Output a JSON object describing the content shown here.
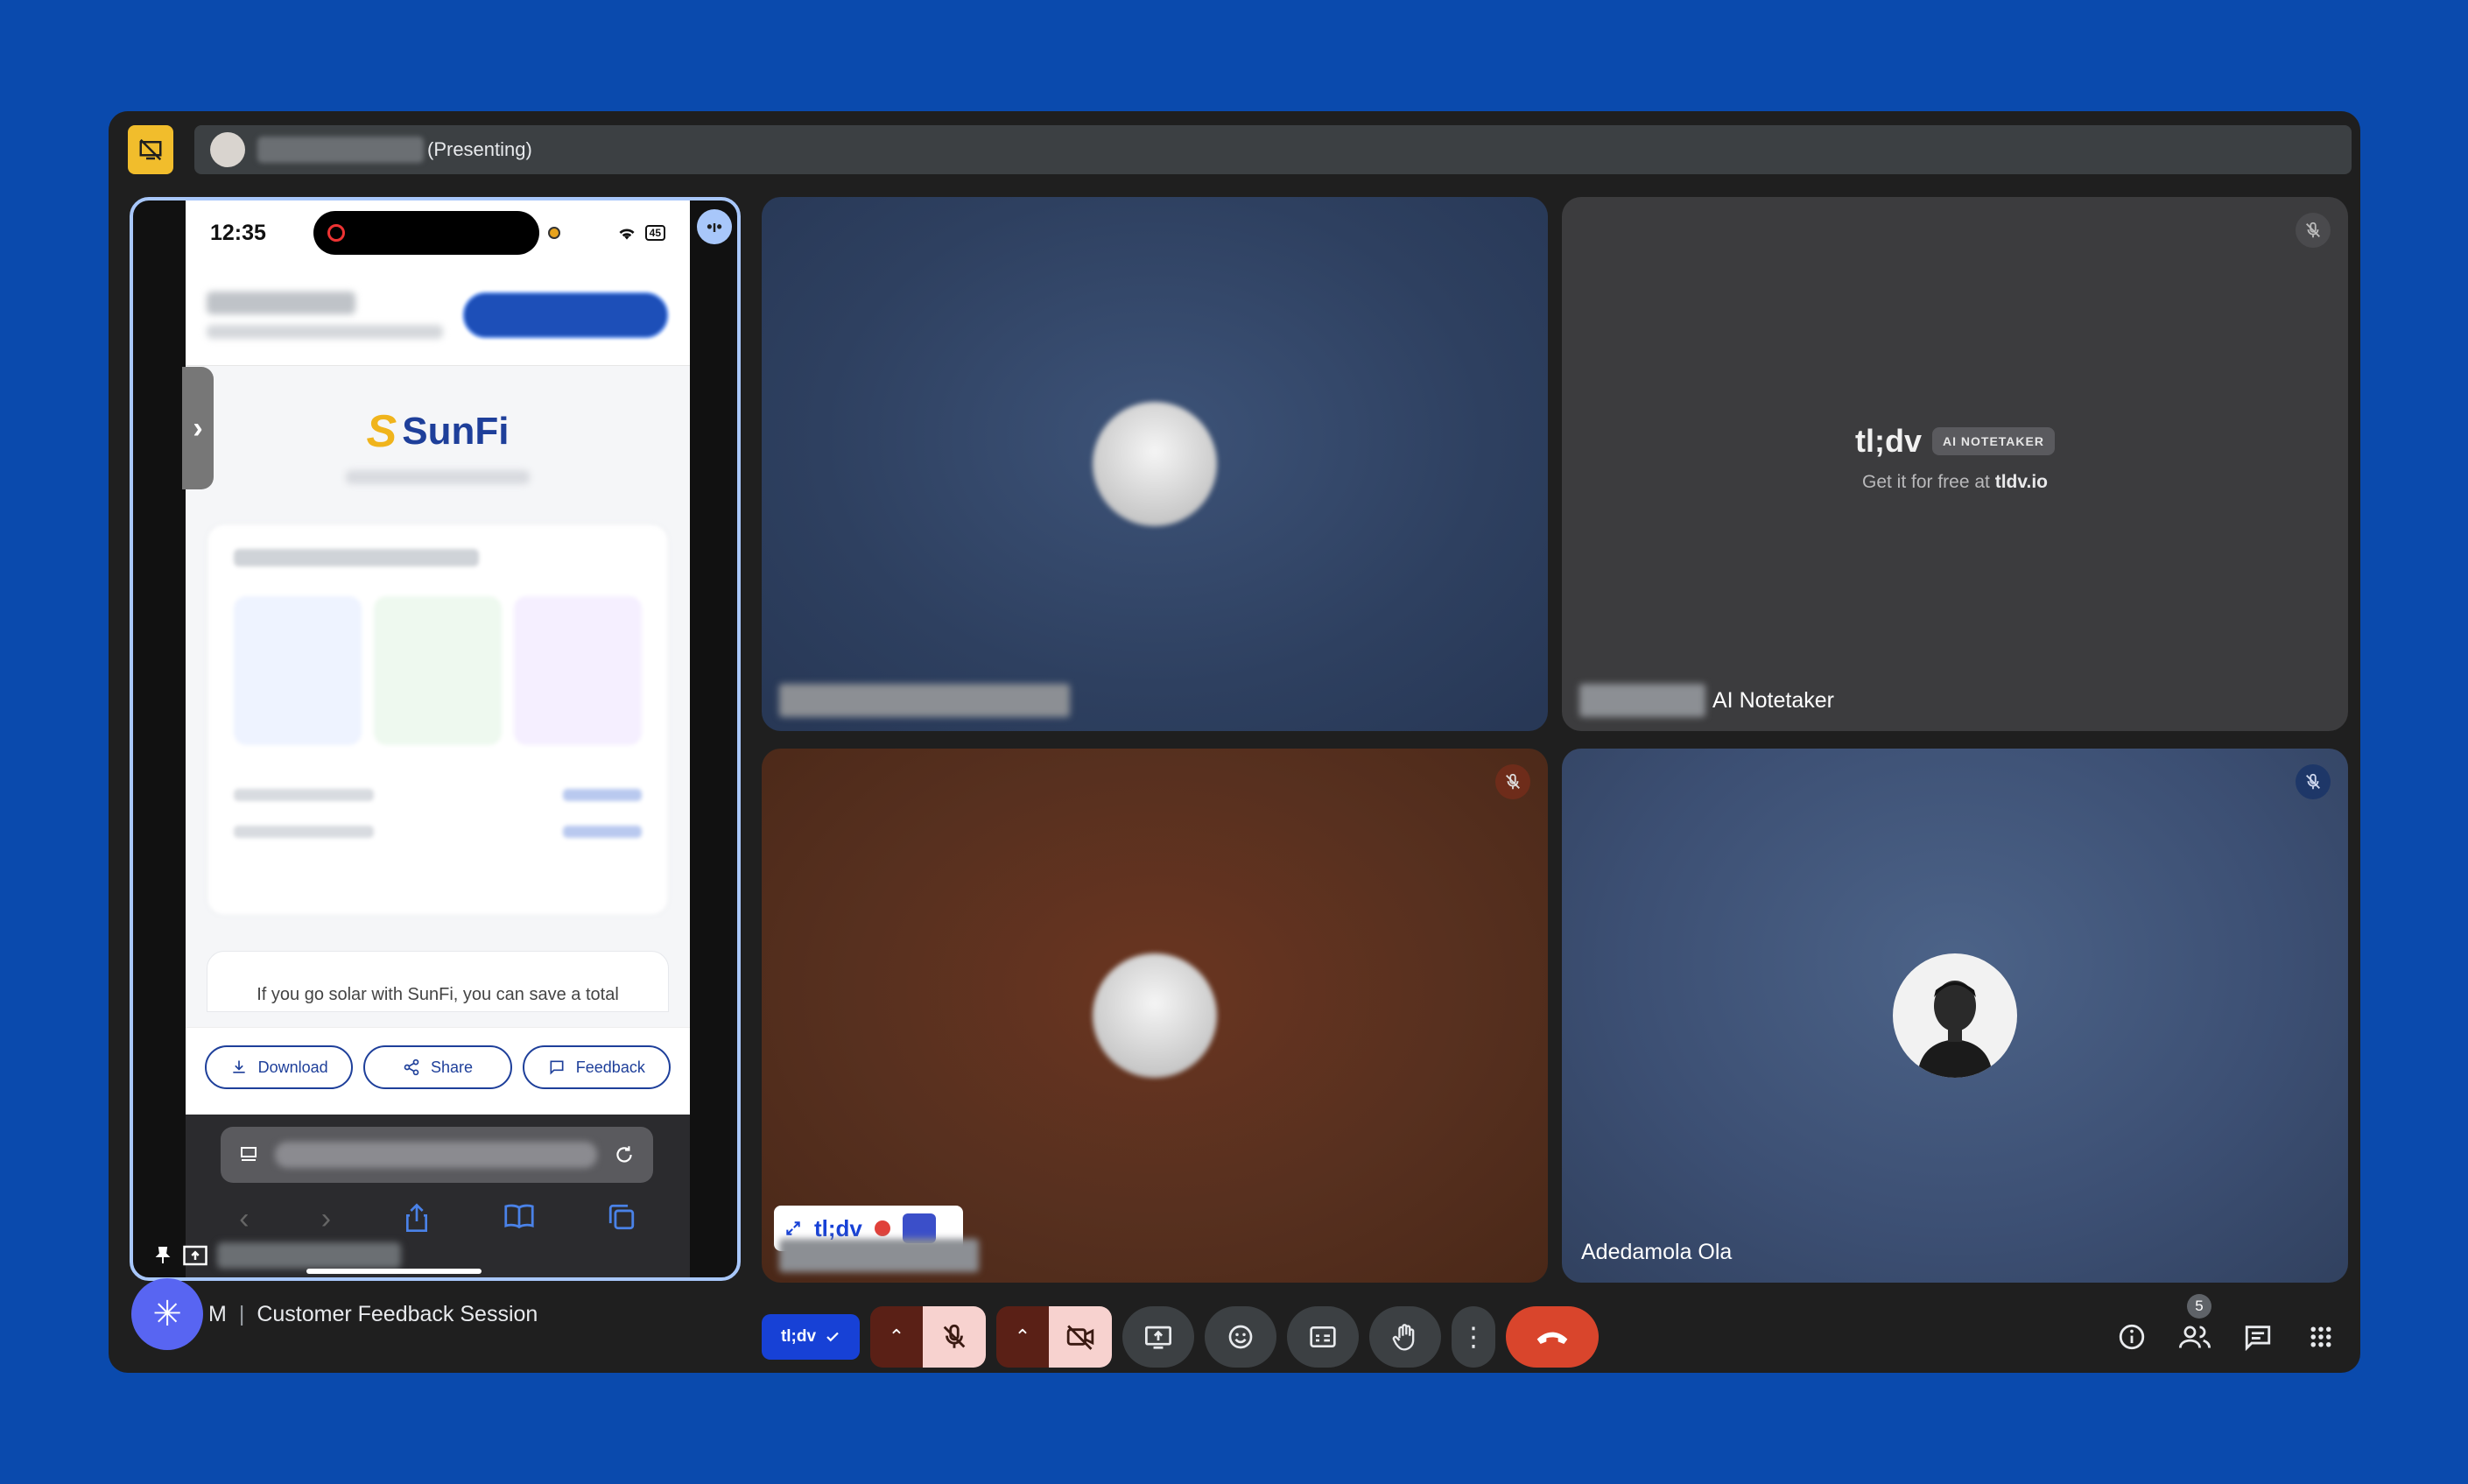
{
  "presenter": {
    "status_label": "(Presenting)"
  },
  "phone": {
    "time": "12:35",
    "battery": "45",
    "brand_s": "S",
    "brand_name": "SunFi",
    "savings_text": "If you go solar with SunFi, you can save a total",
    "actions": [
      {
        "label": "Download",
        "icon": "download-icon"
      },
      {
        "label": "Share",
        "icon": "share-icon"
      },
      {
        "label": "Feedback",
        "icon": "feedback-icon"
      }
    ]
  },
  "tiles": {
    "notetaker": {
      "brand": "tl;dv",
      "pill": "AI NOTETAKER",
      "sub_prefix": "Get it for free at ",
      "sub_link": "tldv.io",
      "name_suffix": "AI Notetaker"
    },
    "widget_brand": "tl;dv",
    "adedamola": {
      "name": "Adedamola Ola"
    }
  },
  "meeting": {
    "code_fragment": "M",
    "separator": "|",
    "title": "Customer Feedback Session"
  },
  "controls": {
    "tldv_label": "tl;dv"
  },
  "people_count": "5",
  "colors": {
    "background": "#0a4aad",
    "window": "#1f1f1f",
    "accent_blue": "#a8c7fa",
    "hangup": "#d9452c",
    "tldv_blue": "#1741d6",
    "sunfi_navy": "#1e3f9a",
    "sunfi_gold": "#f0b41c"
  }
}
